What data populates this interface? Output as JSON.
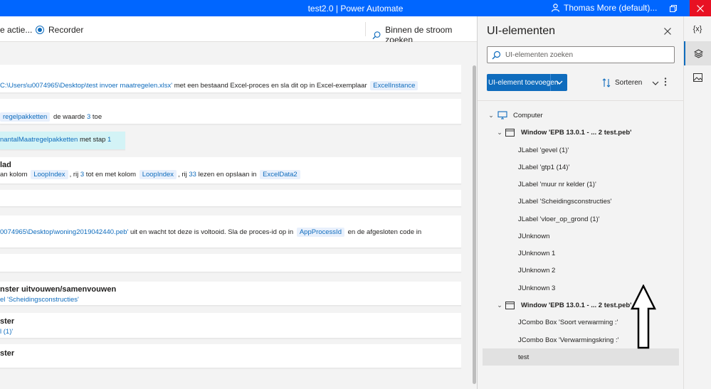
{
  "titlebar": {
    "title": "test2.0 | Power Automate",
    "user": "Thomas More (default)..."
  },
  "toolbar": {
    "run_action": "e actie...",
    "recorder": "Recorder",
    "search_flow": "Binnen de stroom zoeken"
  },
  "flow": {
    "card1": {
      "path": "C:\\Users\\u0074965\\Desktop\\test invoer maatregelen.xlsx'",
      "text": " met een bestaand Excel-proces en sla dit op in Excel-exemplaar ",
      "var": "ExcelInstance"
    },
    "card2": {
      "var": "regelpakketten",
      "text1": " de waarde ",
      "num": "3",
      "text2": " toe"
    },
    "card3": {
      "var": "nantalMaatregelpakketten",
      "text": " met stap ",
      "num": "1"
    },
    "card4": {
      "title": "lad",
      "t1": "an kolom ",
      "v1": "LoopIndex",
      "t2": ", rij ",
      "n1": "3",
      "t3": " tot en met kolom ",
      "v2": "LoopIndex",
      "t4": ", rij ",
      "n2": "33",
      "t5": " lezen en opslaan in ",
      "v3": "ExcelData2"
    },
    "card5": {
      "path": "0074965\\Desktop\\woning2019042440.peb'",
      "text": " uit en wacht tot deze is voltooid. Sla de proces-id op in ",
      "var": "AppProcessId",
      "text2": " en de afgesloten code in"
    },
    "card6": {
      "title": "nster uitvouwen/samenvouwen",
      "sub": "el 'Scheidingsconstructies'"
    },
    "card7": {
      "title": "ster",
      "sub": "l (1)'"
    },
    "card8": {
      "title": "ster"
    }
  },
  "panel": {
    "title": "UI-elementen",
    "search_placeholder": "UI-elementen zoeken",
    "add_button": "UI-element toevoegen",
    "sort": "Sorteren",
    "tree": [
      {
        "label": "Computer",
        "level": 0,
        "type": "computer",
        "expanded": true
      },
      {
        "label": "Window 'EPB 13.0.1 -    ... 2 test.peb'",
        "level": 1,
        "type": "window",
        "expanded": true
      },
      {
        "label": "JLabel 'gevel (1)'",
        "level": 2
      },
      {
        "label": "JLabel 'gtp1 (14)'",
        "level": 2
      },
      {
        "label": "JLabel 'muur nr kelder (1)'",
        "level": 2
      },
      {
        "label": "JLabel 'Scheidingsconstructies'",
        "level": 2
      },
      {
        "label": "JLabel 'vloer_op_grond (1)'",
        "level": 2
      },
      {
        "label": "JUnknown",
        "level": 2
      },
      {
        "label": "JUnknown 1",
        "level": 2
      },
      {
        "label": "JUnknown 2",
        "level": 2
      },
      {
        "label": "JUnknown 3",
        "level": 2
      },
      {
        "label": "Window 'EPB 13.0.1 -    ... 2 test.peb' 2",
        "level": 1,
        "type": "window",
        "expanded": true
      },
      {
        "label": "JCombo Box 'Soort verwarming :'",
        "level": 2
      },
      {
        "label": "JCombo Box 'Verwarmingskring :'",
        "level": 2
      },
      {
        "label": "test",
        "level": 2,
        "selected": true
      }
    ]
  },
  "siderail": {
    "variables": "{x}",
    "ui_elements_icon": "layers-icon",
    "images_icon": "image-icon"
  },
  "colors": {
    "titlebar": "#0066ff",
    "accent": "#0f6cbd",
    "close": "#e81123"
  }
}
